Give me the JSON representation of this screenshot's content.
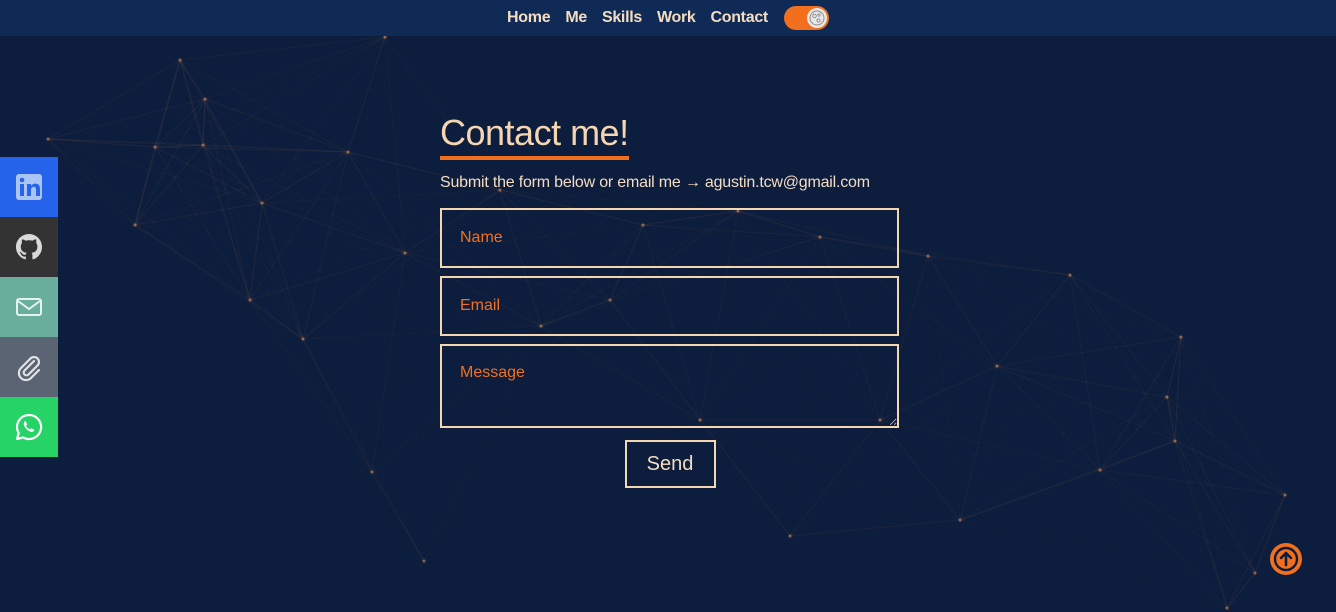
{
  "nav": {
    "links": [
      "Home",
      "Me",
      "Skills",
      "Work",
      "Contact"
    ],
    "toggle_icon": "moon-icon"
  },
  "social": [
    {
      "name": "linkedin",
      "icon": "linkedin-icon",
      "color": "#2563eb"
    },
    {
      "name": "github",
      "icon": "github-icon",
      "color": "#333333"
    },
    {
      "name": "email",
      "icon": "mail-icon",
      "color": "#6aaf9d"
    },
    {
      "name": "resume",
      "icon": "paperclip-icon",
      "color": "#5b6472"
    },
    {
      "name": "whatsapp",
      "icon": "whatsapp-icon",
      "color": "#25d366"
    }
  ],
  "contact": {
    "title": "Contact me!",
    "subtitle": "Submit the form below or email me → agustin.tcw@gmail.com",
    "name_placeholder": "Name",
    "email_placeholder": "Email",
    "message_placeholder": "Message",
    "send_label": "Send"
  },
  "colors": {
    "background": "#0c1d3d",
    "navbar": "#0f2a55",
    "accent": "#f2701d",
    "text": "#f3dcc0"
  },
  "scroll_top_icon": "arrow-up-icon"
}
